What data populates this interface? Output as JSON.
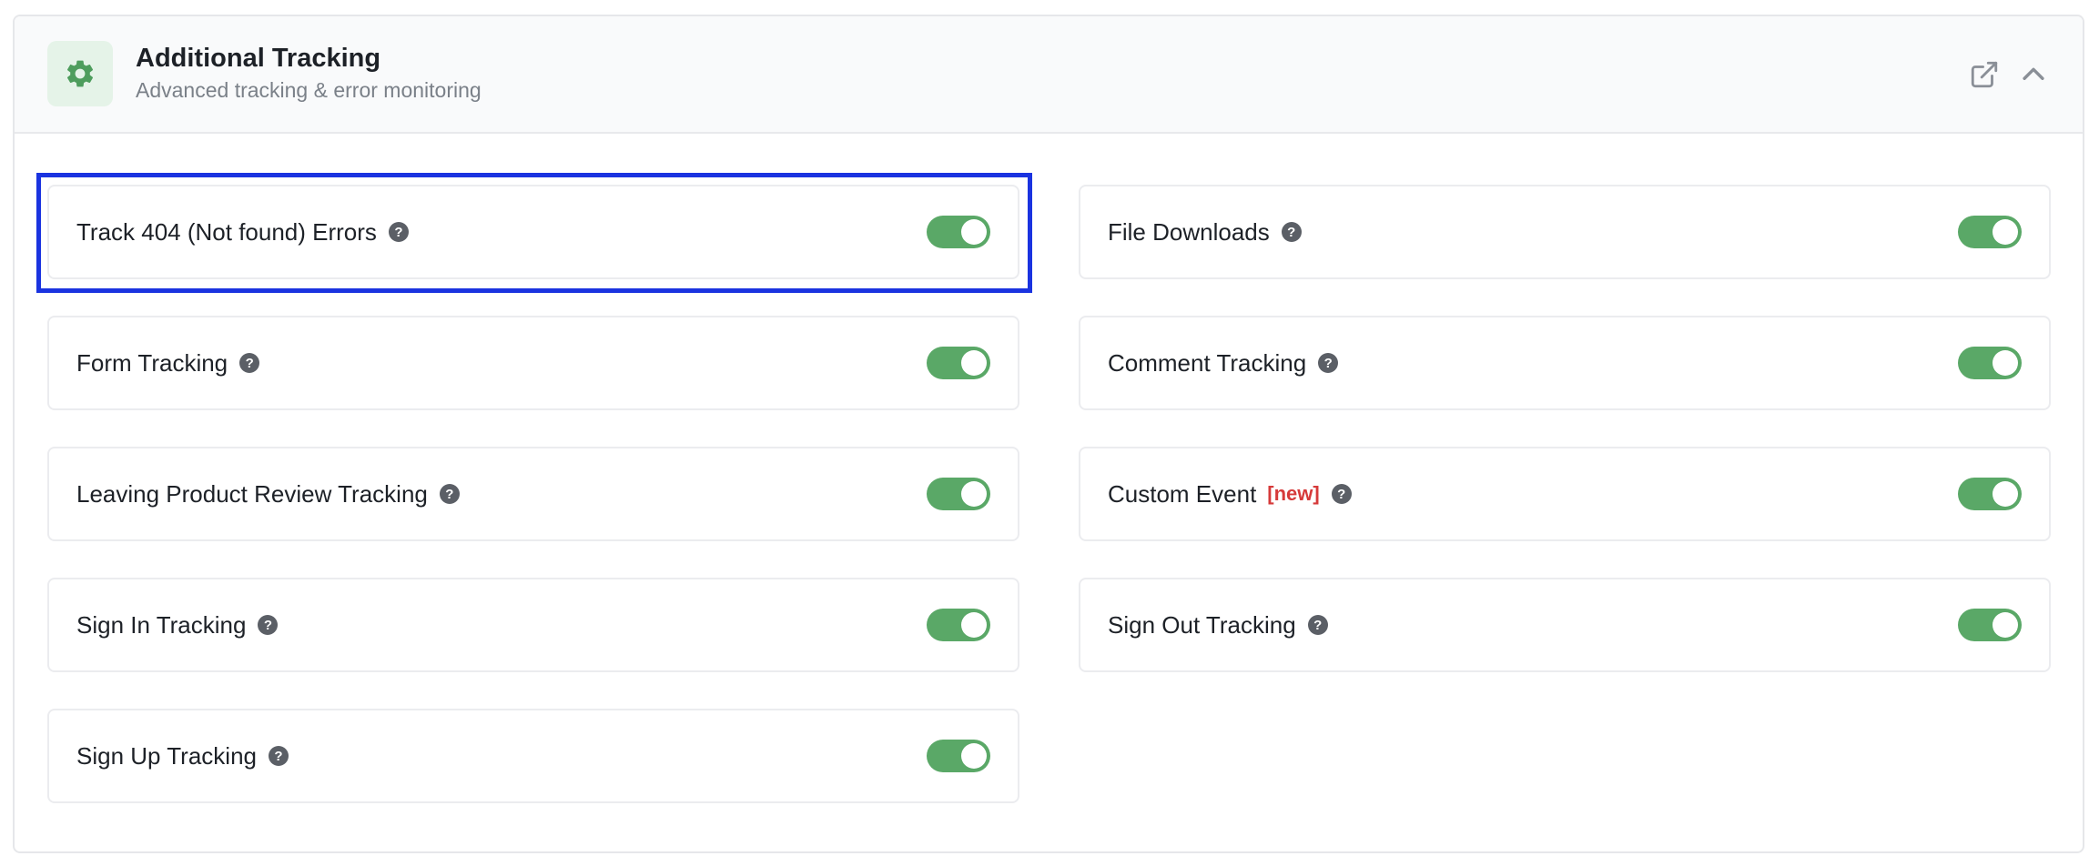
{
  "header": {
    "title": "Additional Tracking",
    "subtitle": "Advanced tracking & error monitoring",
    "icon": "gear-icon",
    "accent_color": "#4e9d5d"
  },
  "settings": [
    {
      "id": "track-404",
      "label": "Track 404 (Not found) Errors",
      "enabled": true,
      "badge": ""
    },
    {
      "id": "file-downloads",
      "label": "File Downloads",
      "enabled": true,
      "badge": ""
    },
    {
      "id": "form-tracking",
      "label": "Form Tracking",
      "enabled": true,
      "badge": ""
    },
    {
      "id": "comment-tracking",
      "label": "Comment Tracking",
      "enabled": true,
      "badge": ""
    },
    {
      "id": "product-review",
      "label": "Leaving Product Review Tracking",
      "enabled": true,
      "badge": ""
    },
    {
      "id": "custom-event",
      "label": "Custom Event",
      "enabled": true,
      "badge": "[new]"
    },
    {
      "id": "sign-in",
      "label": "Sign In Tracking",
      "enabled": true,
      "badge": ""
    },
    {
      "id": "sign-out",
      "label": "Sign Out Tracking",
      "enabled": true,
      "badge": ""
    },
    {
      "id": "sign-up",
      "label": "Sign Up Tracking",
      "enabled": true,
      "badge": ""
    }
  ],
  "help_glyph": "?",
  "colors": {
    "toggle_on": "#5aa867",
    "badge_new": "#d63a3a",
    "highlight": "#1a33e0"
  }
}
